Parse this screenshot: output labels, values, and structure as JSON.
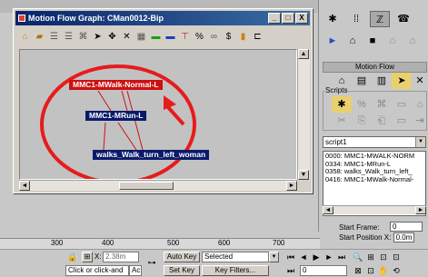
{
  "window": {
    "title": "Motion Flow Graph: CMan0012-Bip",
    "minimize": "_",
    "maximize": "□",
    "close": "X"
  },
  "toolbar_icons": [
    "create-script-icon",
    "open-file-icon",
    "script-icon",
    "script-2-icon",
    "define-script-icon",
    "select-icon",
    "move-icon",
    "delete-icon",
    "grid-icon",
    "random-icon",
    "shared-icon",
    "transition-icon",
    "percent-icon",
    "filter-icon",
    "dollar-icon",
    "bar-icon",
    "right-icon"
  ],
  "graph": {
    "nodes": [
      {
        "label": "MMC1-MWalk-Normal-L",
        "color": "#cc1010"
      },
      {
        "label": "MMC1-MRun-L",
        "color": "#0a1a6a"
      },
      {
        "label": "walks_Walk_turn_left_woman",
        "color": "#0a1a6a"
      }
    ],
    "highlight_color": "#e61c1c"
  },
  "panel": {
    "rollout_title": "Motion Flow",
    "scripts_group": "Scripts",
    "script_selected": "script1",
    "script_list": [
      "0000: MMC1-MWALK-NORM",
      "0334: MMC1-MRun-L",
      "0358: walks_Walk_turn_left_",
      "0416: MMC1-MWalk-Normal-"
    ],
    "start_frame_label": "Start Frame:",
    "start_frame_value": "0",
    "start_position_label": "Start Position X:",
    "start_position_value": "0.0m"
  },
  "timeline": {
    "ticks": [
      "300",
      "400",
      "500",
      "600",
      "700"
    ]
  },
  "status": {
    "x_label": "X:",
    "x_value": "2.38m",
    "auto_key": "Auto Key",
    "selected": "Selected",
    "set_key": "Set Key",
    "key_filters": "Key Filters...",
    "prompt": "Click or click-and",
    "frame_value": "0",
    "ac_text": "Ac"
  }
}
